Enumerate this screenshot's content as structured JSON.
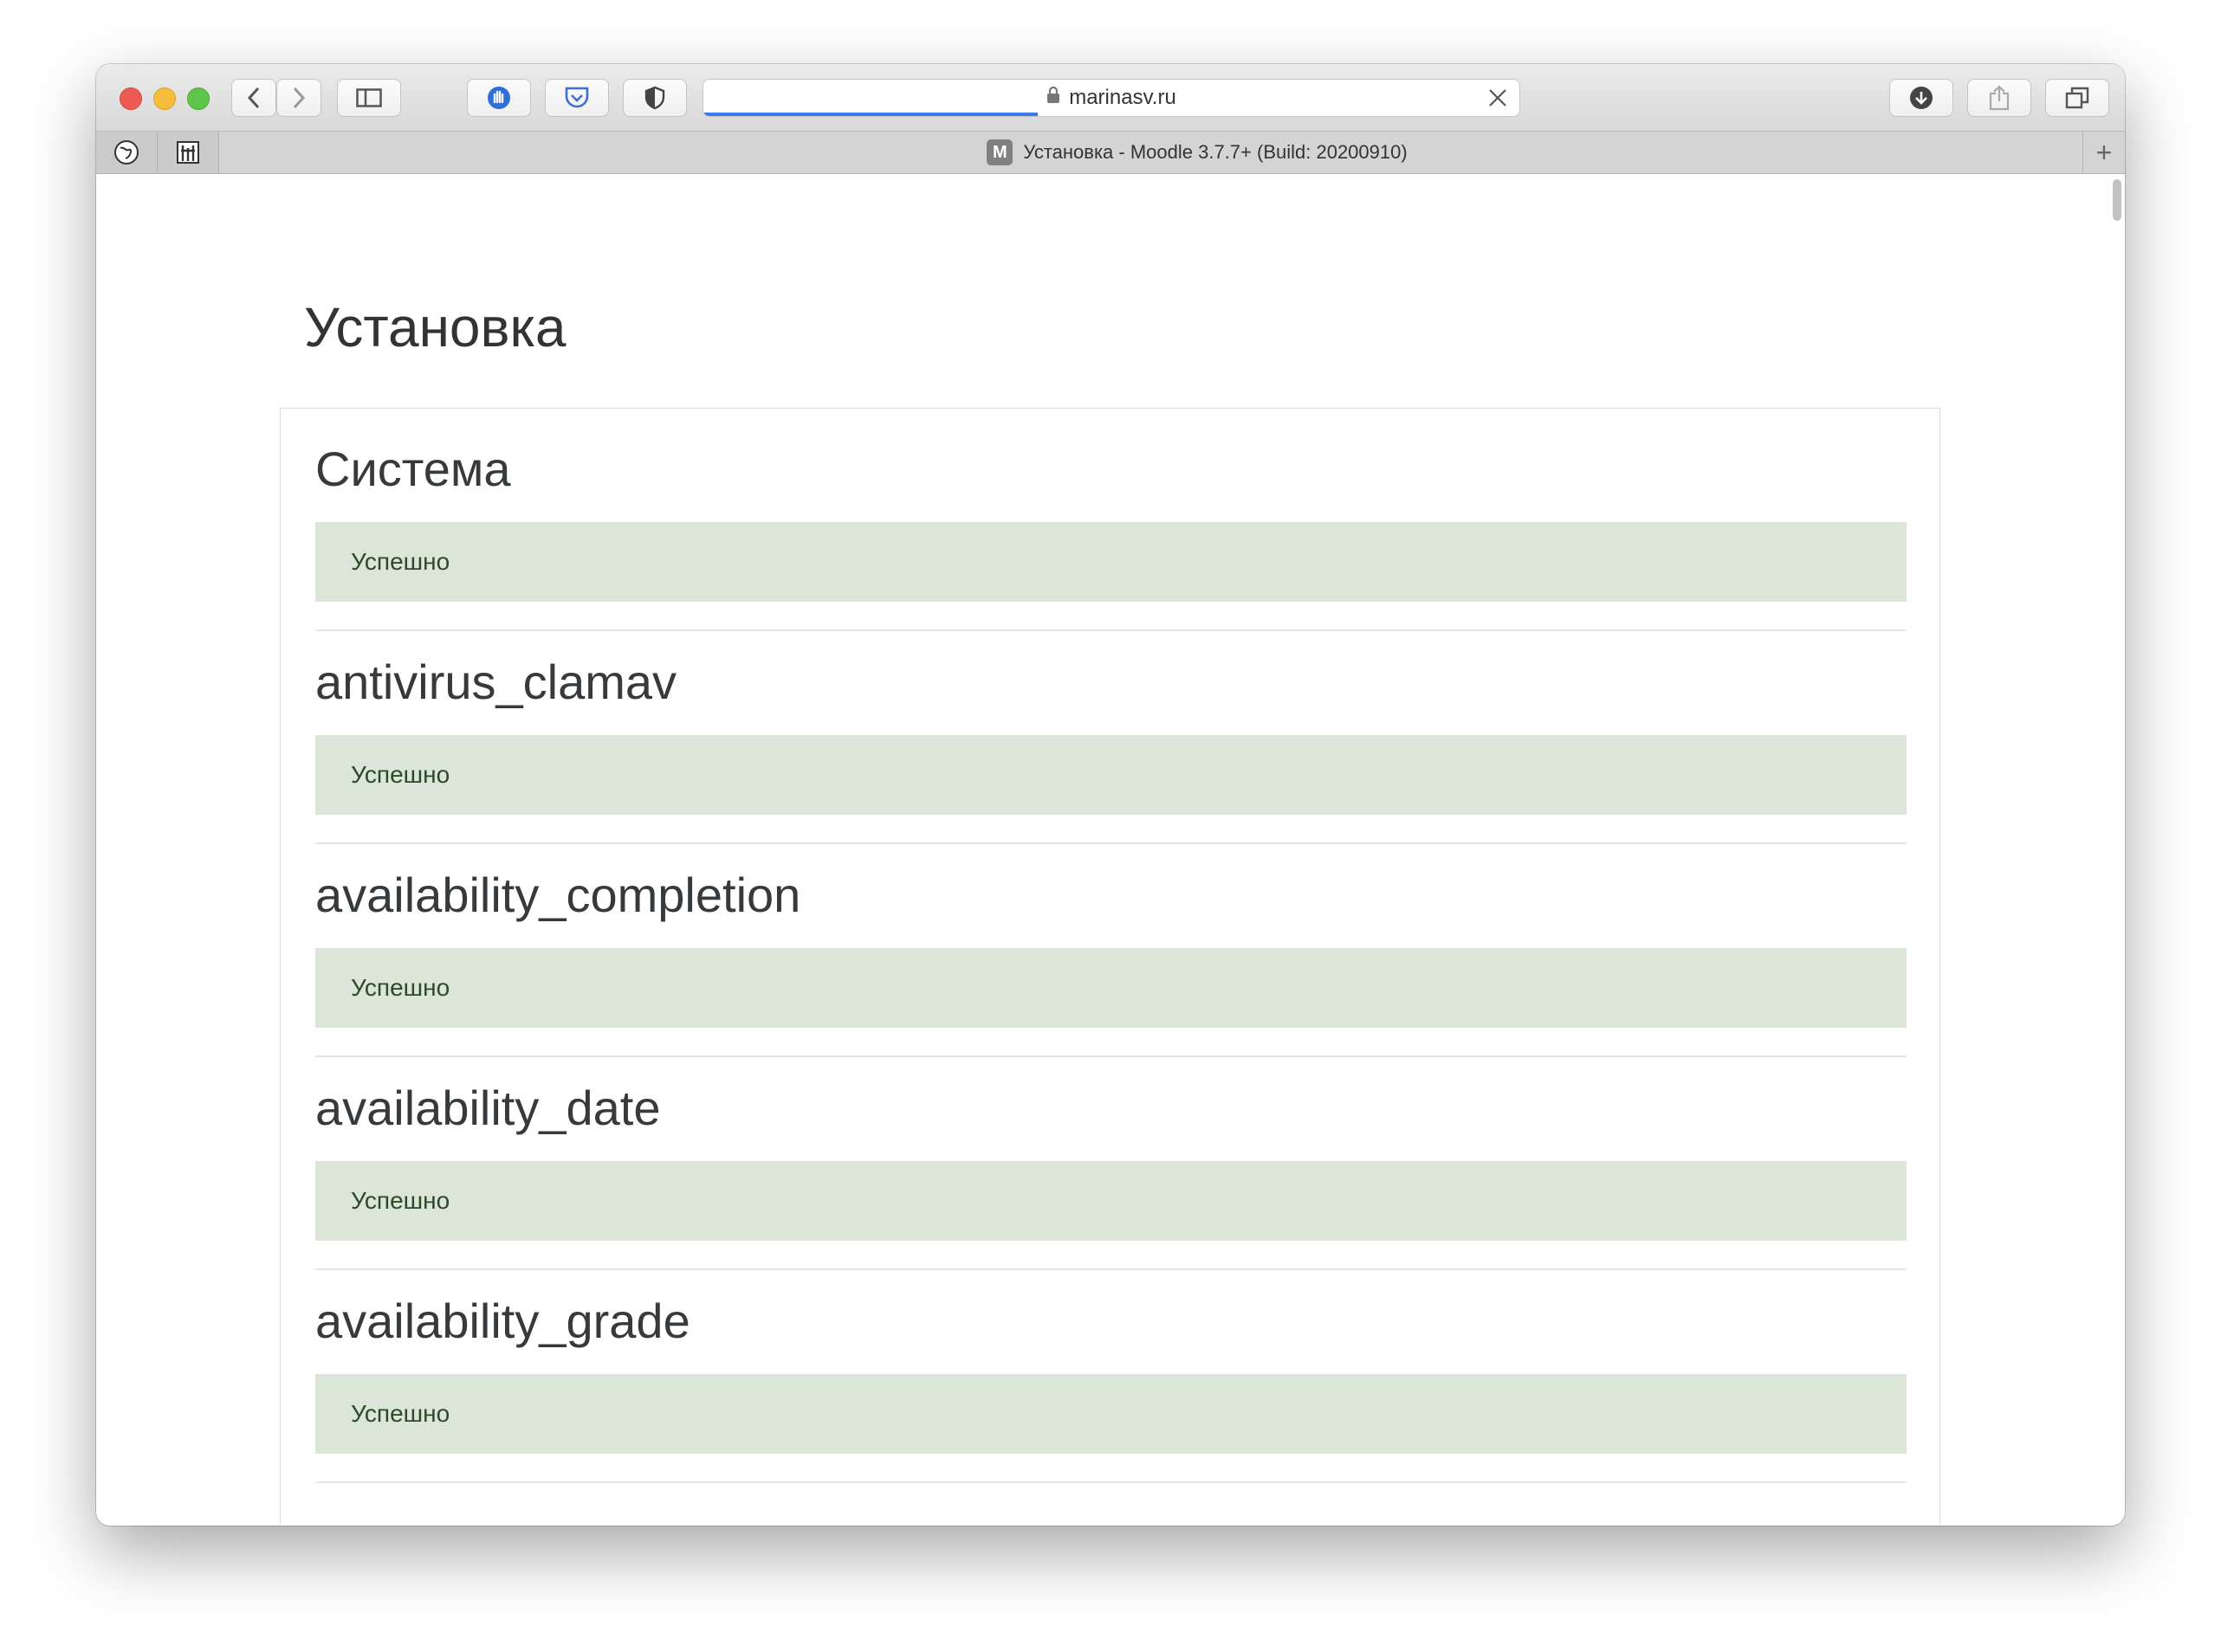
{
  "browser": {
    "address_host": "marinasv.ru",
    "tab_title": "Установка - Moodle 3.7.7+ (Build: 20200910)",
    "favicon_letter": "M",
    "newtab_glyph": "+",
    "progress_fraction": 0.41,
    "icons": [
      "back-icon",
      "forward-icon",
      "sidebar-icon",
      "extension-hand-icon",
      "pocket-icon",
      "shield-icon",
      "lock-icon",
      "stop-icon",
      "download-icon",
      "share-icon",
      "tabs-icon"
    ]
  },
  "page": {
    "title": "Установка"
  },
  "sections": [
    {
      "heading": "Система",
      "status": "Успешно"
    },
    {
      "heading": "antivirus_clamav",
      "status": "Успешно"
    },
    {
      "heading": "availability_completion",
      "status": "Успешно"
    },
    {
      "heading": "availability_date",
      "status": "Успешно"
    },
    {
      "heading": "availability_grade",
      "status": "Успешно"
    }
  ],
  "colors": {
    "success_bg": "#dbe5d8",
    "success_text": "#2d4a28",
    "accent": "#3b7ae8"
  }
}
